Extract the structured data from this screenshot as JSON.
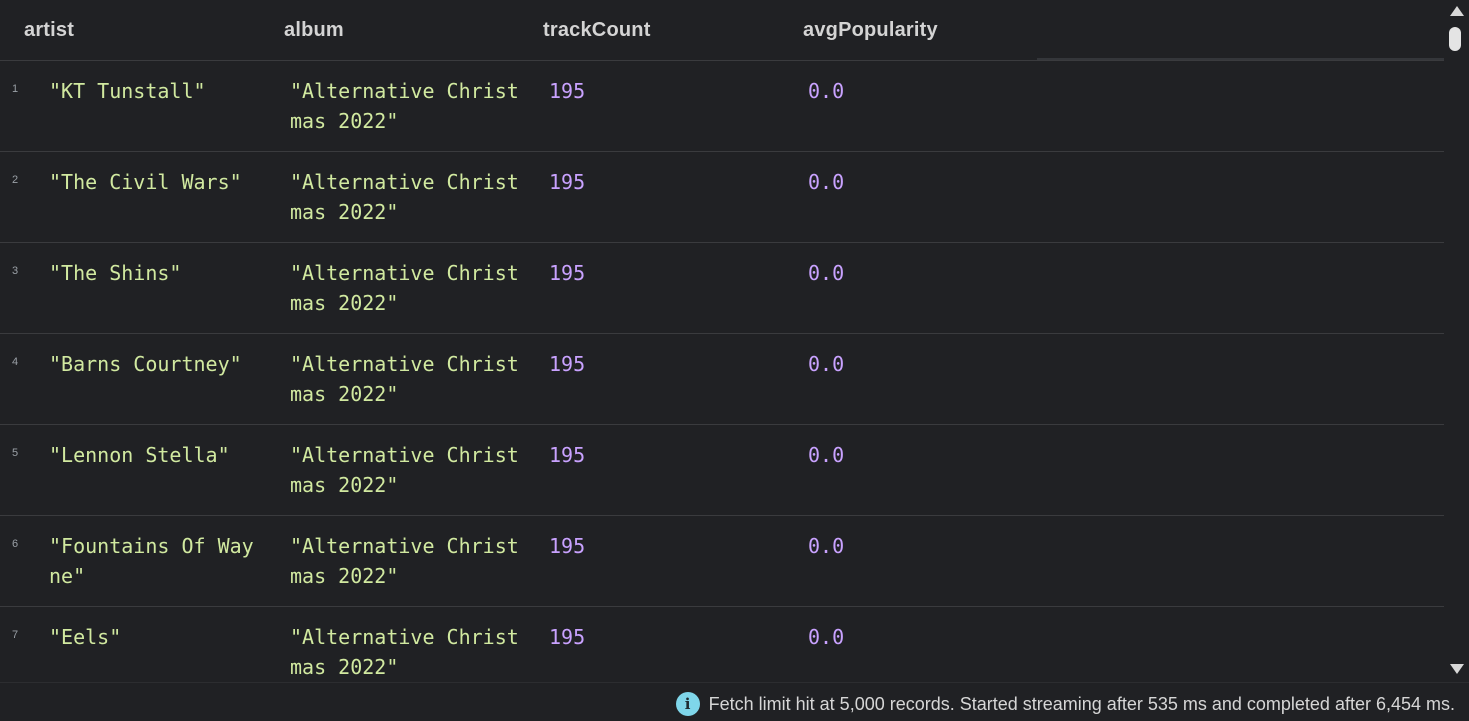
{
  "table": {
    "columns": [
      "artist",
      "album",
      "trackCount",
      "avgPopularity"
    ],
    "rows": [
      {
        "num": "1",
        "artist": "\"KT Tunstall\"",
        "album": "\"Alternative Christ\nmas 2022\"",
        "trackCount": "195",
        "avgPopularity": "0.0"
      },
      {
        "num": "2",
        "artist": "\"The Civil Wars\"",
        "album": "\"Alternative Christ\nmas 2022\"",
        "trackCount": "195",
        "avgPopularity": "0.0"
      },
      {
        "num": "3",
        "artist": "\"The Shins\"",
        "album": "\"Alternative Christ\nmas 2022\"",
        "trackCount": "195",
        "avgPopularity": "0.0"
      },
      {
        "num": "4",
        "artist": "\"Barns Courtney\"",
        "album": "\"Alternative Christ\nmas 2022\"",
        "trackCount": "195",
        "avgPopularity": "0.0"
      },
      {
        "num": "5",
        "artist": "\"Lennon Stella\"",
        "album": "\"Alternative Christ\nmas 2022\"",
        "trackCount": "195",
        "avgPopularity": "0.0"
      },
      {
        "num": "6",
        "artist": "\"Fountains Of Way\nne\"",
        "album": "\"Alternative Christ\nmas 2022\"",
        "trackCount": "195",
        "avgPopularity": "0.0"
      },
      {
        "num": "7",
        "artist": "\"Eels\"",
        "album": "\"Alternative Christ\nmas 2022\"",
        "trackCount": "195",
        "avgPopularity": "0.0"
      }
    ]
  },
  "status": {
    "icon": "info-icon",
    "icon_glyph": "i",
    "message": "Fetch limit hit at 5,000 records. Started streaming after 535 ms and completed after 6,454 ms."
  },
  "colors": {
    "background": "#202124",
    "string_value": "#d1e9a0",
    "number_value": "#c9a2ff",
    "info_accent": "#7fd6ea"
  }
}
